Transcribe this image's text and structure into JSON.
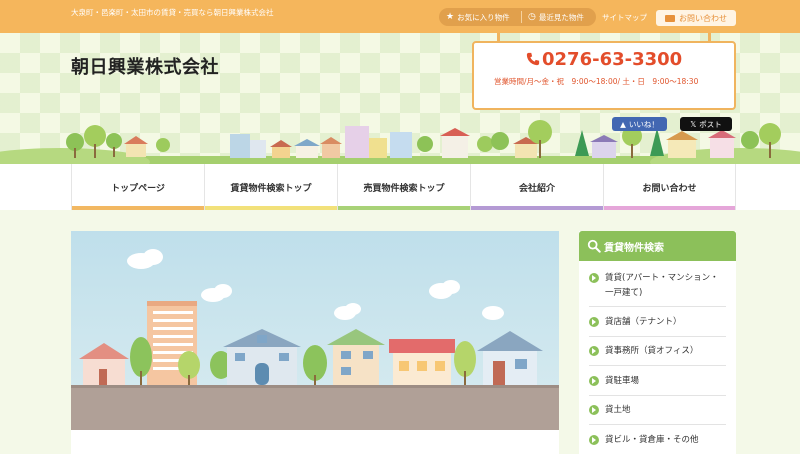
{
  "topbar": {
    "tagline": "大泉町・邑楽町・太田市の賃貸・売買なら朝日興業株式会社",
    "favorites_label": "お気に入り物件",
    "recent_label": "最近見た物件",
    "sitemap_label": "サイトマップ",
    "contact_label": "お問い合わせ"
  },
  "header": {
    "company_name": "朝日興業株式会社",
    "phone": "0276-63-3300",
    "hours": "営業時間/月〜金・祝　9:00〜18:00/ 土・日　9:00〜18:30",
    "like_label": "いいね！",
    "post_label": "ポスト"
  },
  "nav": {
    "items": [
      {
        "label": "トップページ",
        "color": "#f2b862"
      },
      {
        "label": "賃貸物件検索トップ",
        "color": "#f2e17a"
      },
      {
        "label": "売買物件検索トップ",
        "color": "#a8d277"
      },
      {
        "label": "会社紹介",
        "color": "#b49ad4"
      },
      {
        "label": "お問い合わせ",
        "color": "#e5a6d9"
      }
    ]
  },
  "sidebar": {
    "title": "賃貸物件検索",
    "items": [
      {
        "label": "賃貸(アパート・マンション・一戸建て)"
      },
      {
        "label": "貸店舗（テナント）"
      },
      {
        "label": "貸事務所（貸オフィス）"
      },
      {
        "label": "貸駐車場"
      },
      {
        "label": "貸土地"
      },
      {
        "label": "貸ビル・貸倉庫・その他"
      }
    ]
  },
  "colors": {
    "topbar": "#f5b65c",
    "accent_green": "#8cc05a",
    "phone_red": "#e34d2b"
  }
}
